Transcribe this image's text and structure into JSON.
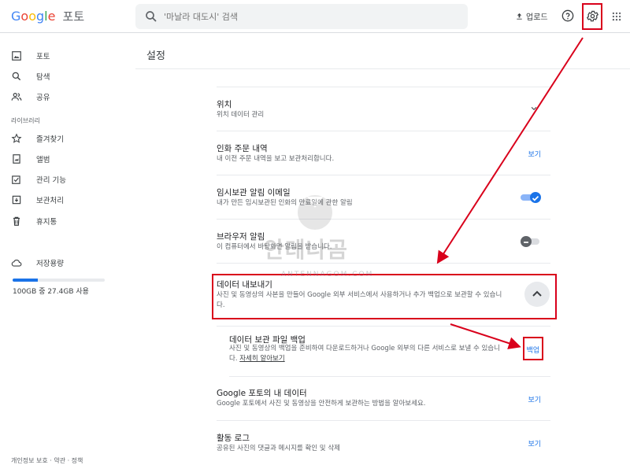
{
  "header": {
    "logo_google": [
      "G",
      "o",
      "o",
      "g",
      "l",
      "e"
    ],
    "logo_product": "포토",
    "search_placeholder": "'마날라 대도시' 검색",
    "upload_label": "업로드"
  },
  "sidebar": {
    "items": [
      {
        "label": "포토",
        "icon": "photo-icon"
      },
      {
        "label": "탐색",
        "icon": "search-icon"
      },
      {
        "label": "공유",
        "icon": "people-icon"
      }
    ],
    "library_label": "라이브러리",
    "library_items": [
      {
        "label": "즐겨찾기",
        "icon": "star-icon"
      },
      {
        "label": "앨범",
        "icon": "album-icon"
      },
      {
        "label": "관리 기능",
        "icon": "checklist-icon"
      },
      {
        "label": "보관처리",
        "icon": "archive-icon"
      },
      {
        "label": "휴지통",
        "icon": "trash-icon"
      }
    ],
    "storage_label": "저장용량",
    "storage_text": "100GB 중 27.4GB 사용",
    "storage_fraction": 0.274,
    "footer": "개인정보 보호 · 약관 · 정책"
  },
  "main": {
    "title": "설정",
    "rows": {
      "location": {
        "title": "위치",
        "desc": "위치 데이터 관리"
      },
      "print_orders": {
        "title": "인화 주문 내역",
        "desc": "내 이전 주문 내역을 보고 보관처리합니다.",
        "link": "보기"
      },
      "temp_email": {
        "title": "임시보관 알림 이메일",
        "desc": "내가 만든 임시보관된 인화의 만료일에 관한 알림",
        "toggle_on": true
      },
      "browser_alert": {
        "title": "브라우저 알림",
        "desc": "이 컴퓨터에서 바탕화면 알림을 받습니다.",
        "toggle_on": false
      },
      "data_export": {
        "title": "데이터 내보내기",
        "desc": "사진 및 동영상의 사본을 만들어 Google 외부 서비스에서 사용하거나 추가 백업으로 보관할 수 있습니다."
      },
      "backup": {
        "title": "데이터 보관 파일 백업",
        "desc": "사진 및 동영상의 백업을 준비하여 다운로드하거나 Google 외부의 다른 서비스로 보낼 수 있습니다.",
        "learn_more": "자세히 알아보기",
        "link": "백업"
      },
      "my_data": {
        "title": "Google 포토의 내 데이터",
        "desc": "Google 포토에서 사진 및 동영상을 안전하게 보관하는 방법을 알아보세요.",
        "link": "보기"
      },
      "activity": {
        "title": "활동 로그",
        "desc": "공유된 사진의 댓글과 메시지를 확인 및 삭제",
        "link": "보기"
      }
    }
  },
  "watermark": {
    "main": "안테나곰",
    "sub": "ANTENNAGOM.COM"
  },
  "colors": {
    "accent": "#1a73e8",
    "annotation": "#d9001b"
  }
}
